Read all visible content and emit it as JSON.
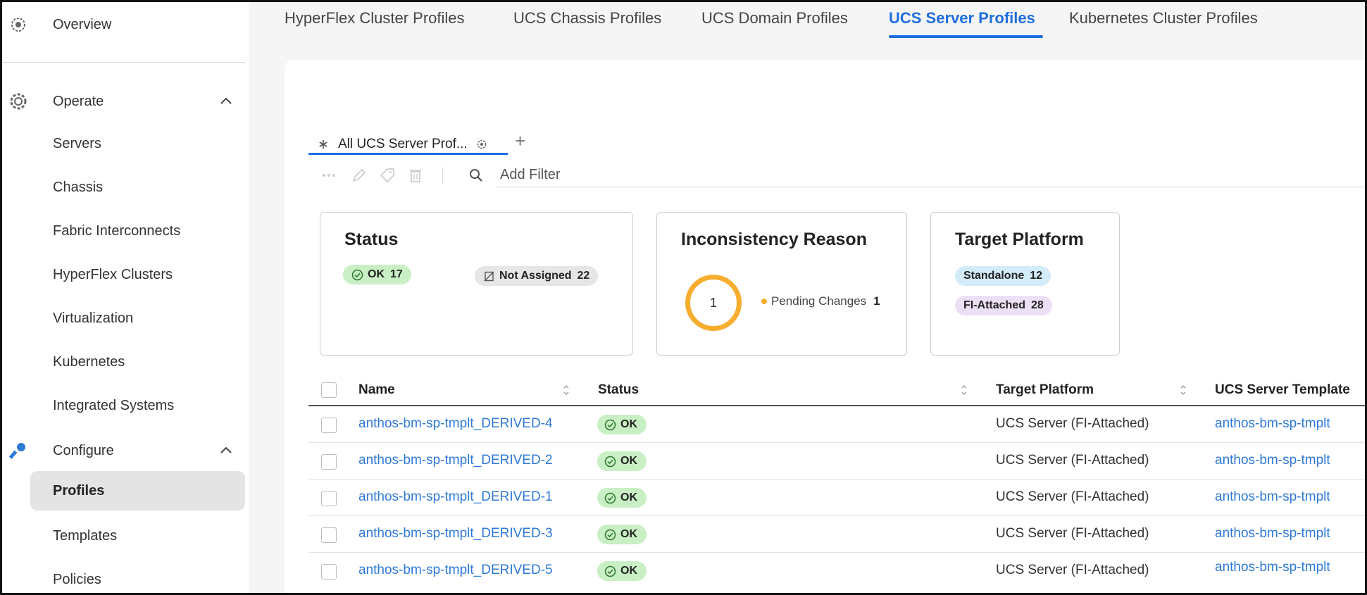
{
  "sidebar": {
    "overview": "Overview",
    "operate": "Operate",
    "operate_items": [
      "Servers",
      "Chassis",
      "Fabric Interconnects",
      "HyperFlex Clusters",
      "Virtualization",
      "Kubernetes",
      "Integrated Systems"
    ],
    "configure": "Configure",
    "configure_items": [
      "Profiles",
      "Templates",
      "Policies"
    ],
    "active_item": "Profiles"
  },
  "tabs": [
    "HyperFlex Cluster Profiles",
    "UCS Chassis Profiles",
    "UCS Domain Profiles",
    "UCS Server Profiles",
    "Kubernetes Cluster Profiles"
  ],
  "active_tab": "UCS Server Profiles",
  "view_tab": {
    "label": "All UCS Server Prof..."
  },
  "filter": {
    "placeholder": "Add Filter"
  },
  "cards": {
    "status": {
      "title": "Status",
      "ok_label": "OK",
      "ok_count": "17",
      "na_label": "Not Assigned",
      "na_count": "22"
    },
    "inconsistency": {
      "title": "Inconsistency Reason",
      "ring_value": "1",
      "legend_label": "Pending Changes",
      "legend_count": "1"
    },
    "platform": {
      "title": "Target Platform",
      "standalone_label": "Standalone",
      "standalone_count": "12",
      "fi_label": "FI-Attached",
      "fi_count": "28"
    }
  },
  "table": {
    "columns": [
      "Name",
      "Status",
      "Target Platform",
      "UCS Server Template"
    ],
    "rows": [
      {
        "name": "anthos-bm-sp-tmplt_DERIVED-4",
        "status": "OK",
        "platform": "UCS Server (FI-Attached)",
        "template": "anthos-bm-sp-tmplt"
      },
      {
        "name": "anthos-bm-sp-tmplt_DERIVED-2",
        "status": "OK",
        "platform": "UCS Server (FI-Attached)",
        "template": "anthos-bm-sp-tmplt"
      },
      {
        "name": "anthos-bm-sp-tmplt_DERIVED-1",
        "status": "OK",
        "platform": "UCS Server (FI-Attached)",
        "template": "anthos-bm-sp-tmplt"
      },
      {
        "name": "anthos-bm-sp-tmplt_DERIVED-3",
        "status": "OK",
        "platform": "UCS Server (FI-Attached)",
        "template": "anthos-bm-sp-tmplt"
      },
      {
        "name": "anthos-bm-sp-tmplt_DERIVED-5",
        "status": "OK",
        "platform": "UCS Server (FI-Attached)",
        "template": "anthos-bm-sp-tmplt"
      }
    ]
  },
  "colors": {
    "accent": "#1e6ee0",
    "link": "#2f7ad6",
    "ok_bg": "#c9efc4",
    "ring": "#f7ad2e"
  }
}
